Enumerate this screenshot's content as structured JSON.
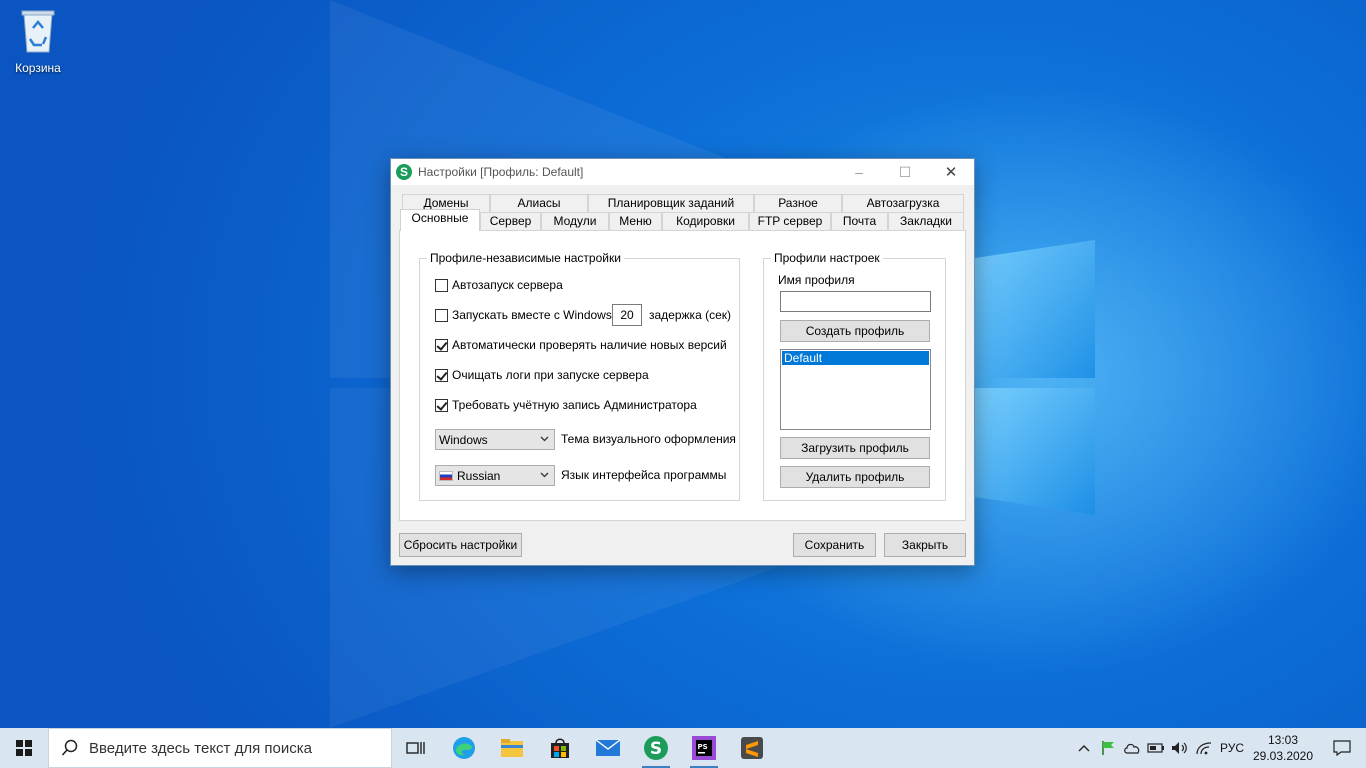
{
  "desktop": {
    "recycle_bin_label": "Корзина"
  },
  "window": {
    "title": "Настройки [Профиль: Default]",
    "app_icon_letter": "S",
    "tabs_row1": [
      "Домены",
      "Алиасы",
      "Планировщик заданий",
      "Разное",
      "Автозагрузка"
    ],
    "tabs_row2": [
      "Основные",
      "Сервер",
      "Модули",
      "Меню",
      "Кодировки",
      "FTP сервер",
      "Почта",
      "Закладки"
    ],
    "active_tab": "Основные",
    "general": {
      "group_title": "Профиле-независимые настройки",
      "autostart_label": "Автозапуск сервера",
      "autostart_checked": false,
      "start_with_windows_label": "Запускать вместе с Windows",
      "start_with_windows_checked": false,
      "delay_value": "20",
      "delay_label": "задержка (сек)",
      "check_updates_label": "Автоматически проверять наличие новых версий",
      "check_updates_checked": true,
      "clear_logs_label": "Очищать логи при запуске сервера",
      "clear_logs_checked": true,
      "require_admin_label": "Требовать учётную запись Администратора",
      "require_admin_checked": true,
      "theme_value": "Windows",
      "theme_label": "Тема визуального оформления",
      "language_value": "Russian",
      "language_label": "Язык интерфейса программы"
    },
    "profiles": {
      "group_title": "Профили настроек",
      "name_label": "Имя профиля",
      "name_value": "",
      "create_button": "Создать профиль",
      "list_items": [
        "Default"
      ],
      "selected_item": "Default",
      "load_button": "Загрузить профиль",
      "delete_button": "Удалить профиль"
    },
    "reset_button": "Сбросить настройки",
    "save_button": "Сохранить",
    "close_button": "Закрыть"
  },
  "taskbar": {
    "search_placeholder": "Введите здесь текст для поиска",
    "language_indicator": "РУС",
    "time": "13:03",
    "date": "29.03.2020"
  },
  "colors": {
    "accent": "#0078d7",
    "app_icon": "#1b9c5a",
    "desktop": "#0a6fd6"
  }
}
